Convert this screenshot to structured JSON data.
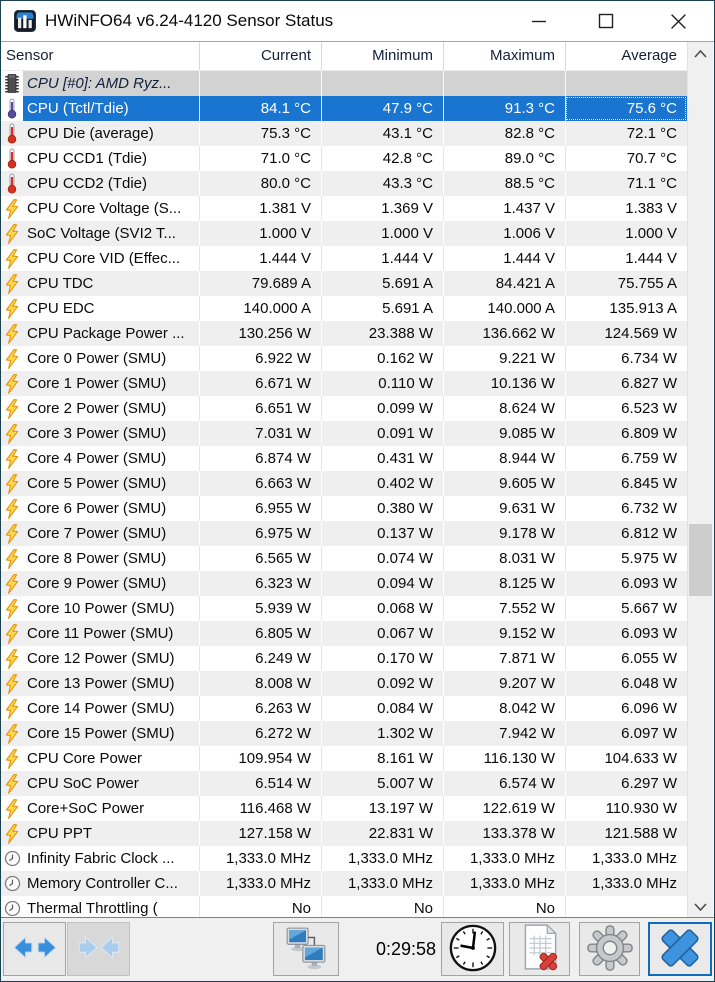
{
  "window": {
    "title": "HWiNFO64 v6.24-4120 Sensor Status",
    "controls": [
      "minimize",
      "maximize",
      "close"
    ]
  },
  "colors": {
    "selection_blue": "#1975d0",
    "row_alt_gray": "#efefef",
    "group_row_gray": "#d2d2d2",
    "close_button_accent": "#0f6cbd"
  },
  "table": {
    "columns": [
      "Sensor",
      "Current",
      "Minimum",
      "Maximum",
      "Average"
    ],
    "rows": [
      {
        "type": "group",
        "icon": "chip",
        "label": "CPU [#0]: AMD Ryz...",
        "values": [
          "",
          "",
          "",
          ""
        ]
      },
      {
        "icon": "thermometer-purple",
        "label": "CPU (Tctl/Tdie)",
        "selected": true,
        "values": [
          "84.1 °C",
          "47.9 °C",
          "91.3 °C",
          "75.6 °C"
        ]
      },
      {
        "icon": "thermometer-red",
        "label": "CPU Die (average)",
        "values": [
          "75.3 °C",
          "43.1 °C",
          "82.8 °C",
          "72.1 °C"
        ]
      },
      {
        "icon": "thermometer-red",
        "label": "CPU CCD1 (Tdie)",
        "values": [
          "71.0 °C",
          "42.8 °C",
          "89.0 °C",
          "70.7 °C"
        ]
      },
      {
        "icon": "thermometer-red",
        "label": "CPU CCD2 (Tdie)",
        "values": [
          "80.0 °C",
          "43.3 °C",
          "88.5 °C",
          "71.1 °C"
        ]
      },
      {
        "icon": "lightning",
        "label": "CPU Core Voltage (S...",
        "values": [
          "1.381 V",
          "1.369 V",
          "1.437 V",
          "1.383 V"
        ]
      },
      {
        "icon": "lightning",
        "label": "SoC Voltage (SVI2 T...",
        "values": [
          "1.000 V",
          "1.000 V",
          "1.006 V",
          "1.000 V"
        ]
      },
      {
        "icon": "lightning",
        "label": "CPU Core VID (Effec...",
        "values": [
          "1.444 V",
          "1.444 V",
          "1.444 V",
          "1.444 V"
        ]
      },
      {
        "icon": "lightning",
        "label": "CPU TDC",
        "values": [
          "79.689 A",
          "5.691 A",
          "84.421 A",
          "75.755 A"
        ]
      },
      {
        "icon": "lightning",
        "label": "CPU EDC",
        "values": [
          "140.000 A",
          "5.691 A",
          "140.000 A",
          "135.913 A"
        ]
      },
      {
        "icon": "lightning",
        "label": "CPU Package Power ...",
        "values": [
          "130.256 W",
          "23.388 W",
          "136.662 W",
          "124.569 W"
        ]
      },
      {
        "icon": "lightning",
        "label": "Core 0 Power (SMU)",
        "values": [
          "6.922 W",
          "0.162 W",
          "9.221 W",
          "6.734 W"
        ]
      },
      {
        "icon": "lightning",
        "label": "Core 1 Power (SMU)",
        "values": [
          "6.671 W",
          "0.110 W",
          "10.136 W",
          "6.827 W"
        ]
      },
      {
        "icon": "lightning",
        "label": "Core 2 Power (SMU)",
        "values": [
          "6.651 W",
          "0.099 W",
          "8.624 W",
          "6.523 W"
        ]
      },
      {
        "icon": "lightning",
        "label": "Core 3 Power (SMU)",
        "values": [
          "7.031 W",
          "0.091 W",
          "9.085 W",
          "6.809 W"
        ]
      },
      {
        "icon": "lightning",
        "label": "Core 4 Power (SMU)",
        "values": [
          "6.874 W",
          "0.431 W",
          "8.944 W",
          "6.759 W"
        ]
      },
      {
        "icon": "lightning",
        "label": "Core 5 Power (SMU)",
        "values": [
          "6.663 W",
          "0.402 W",
          "9.605 W",
          "6.845 W"
        ]
      },
      {
        "icon": "lightning",
        "label": "Core 6 Power (SMU)",
        "values": [
          "6.955 W",
          "0.380 W",
          "9.631 W",
          "6.732 W"
        ]
      },
      {
        "icon": "lightning",
        "label": "Core 7 Power (SMU)",
        "values": [
          "6.975 W",
          "0.137 W",
          "9.178 W",
          "6.812 W"
        ]
      },
      {
        "icon": "lightning",
        "label": "Core 8 Power (SMU)",
        "values": [
          "6.565 W",
          "0.074 W",
          "8.031 W",
          "5.975 W"
        ]
      },
      {
        "icon": "lightning",
        "label": "Core 9 Power (SMU)",
        "values": [
          "6.323 W",
          "0.094 W",
          "8.125 W",
          "6.093 W"
        ]
      },
      {
        "icon": "lightning",
        "label": "Core 10 Power (SMU)",
        "values": [
          "5.939 W",
          "0.068 W",
          "7.552 W",
          "5.667 W"
        ]
      },
      {
        "icon": "lightning",
        "label": "Core 11 Power (SMU)",
        "values": [
          "6.805 W",
          "0.067 W",
          "9.152 W",
          "6.093 W"
        ]
      },
      {
        "icon": "lightning",
        "label": "Core 12 Power (SMU)",
        "values": [
          "6.249 W",
          "0.170 W",
          "7.871 W",
          "6.055 W"
        ]
      },
      {
        "icon": "lightning",
        "label": "Core 13 Power (SMU)",
        "values": [
          "8.008 W",
          "0.092 W",
          "9.207 W",
          "6.048 W"
        ]
      },
      {
        "icon": "lightning",
        "label": "Core 14 Power (SMU)",
        "values": [
          "6.263 W",
          "0.084 W",
          "8.042 W",
          "6.096 W"
        ]
      },
      {
        "icon": "lightning",
        "label": "Core 15 Power (SMU)",
        "values": [
          "6.272 W",
          "1.302 W",
          "7.942 W",
          "6.097 W"
        ]
      },
      {
        "icon": "lightning",
        "label": "CPU Core Power",
        "values": [
          "109.954 W",
          "8.161 W",
          "116.130 W",
          "104.633 W"
        ]
      },
      {
        "icon": "lightning",
        "label": "CPU SoC Power",
        "values": [
          "6.514 W",
          "5.007 W",
          "6.574 W",
          "6.297 W"
        ]
      },
      {
        "icon": "lightning",
        "label": "Core+SoC Power",
        "values": [
          "116.468 W",
          "13.197 W",
          "122.619 W",
          "110.930 W"
        ]
      },
      {
        "icon": "lightning",
        "label": "CPU PPT",
        "values": [
          "127.158 W",
          "22.831 W",
          "133.378 W",
          "121.588 W"
        ]
      },
      {
        "icon": "clock",
        "label": "Infinity Fabric Clock ...",
        "values": [
          "1,333.0 MHz",
          "1,333.0 MHz",
          "1,333.0 MHz",
          "1,333.0 MHz"
        ]
      },
      {
        "icon": "clock",
        "label": "Memory Controller C...",
        "values": [
          "1,333.0 MHz",
          "1,333.0 MHz",
          "1,333.0 MHz",
          "1,333.0 MHz"
        ]
      },
      {
        "icon": "clock",
        "label": "Thermal Throttling (",
        "values": [
          "No",
          "No",
          "No",
          ""
        ]
      }
    ]
  },
  "toolbar": {
    "time": "0:29:58",
    "buttons": [
      {
        "name": "expand-columns-button",
        "icon": "expand-arrows-icon"
      },
      {
        "name": "collapse-columns-button",
        "icon": "collapse-arrows-icon"
      },
      {
        "name": "remote-monitoring-button",
        "icon": "dual-monitors-icon"
      },
      {
        "name": "clock-button",
        "icon": "clock-icon"
      },
      {
        "name": "logging-button",
        "icon": "report-cancel-icon"
      },
      {
        "name": "settings-button",
        "icon": "gear-icon"
      },
      {
        "name": "close-button",
        "icon": "blue-x-icon"
      }
    ]
  }
}
